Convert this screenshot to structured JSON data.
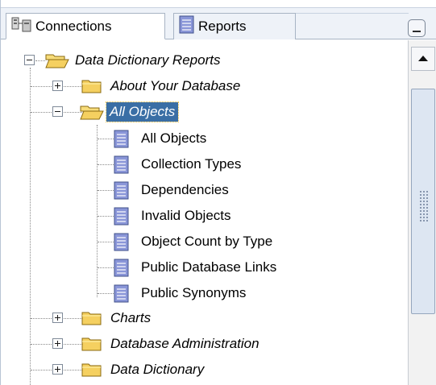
{
  "tabs": [
    {
      "label": "Connections",
      "icon": "connections-icon",
      "active": true
    },
    {
      "label": "Reports",
      "icon": "report-doc-icon",
      "active": false
    }
  ],
  "tree": {
    "root": {
      "label": "Data Dictionary Reports",
      "expanded": true
    },
    "about_db": {
      "label": "About Your Database",
      "expanded": false
    },
    "all_objects": {
      "label": "All Objects",
      "expanded": true,
      "selected": true,
      "children": [
        "All Objects",
        "Collection Types",
        "Dependencies",
        "Invalid Objects",
        "Object Count by Type",
        "Public Database Links",
        "Public Synonyms"
      ]
    },
    "charts": {
      "label": "Charts",
      "expanded": false
    },
    "db_admin": {
      "label": "Database Administration",
      "expanded": false
    },
    "data_dict": {
      "label": "Data Dictionary",
      "expanded": false
    }
  },
  "colors": {
    "selection": "#3a6ea5",
    "folder": "#f0c848",
    "report": "#6c7cc8"
  }
}
